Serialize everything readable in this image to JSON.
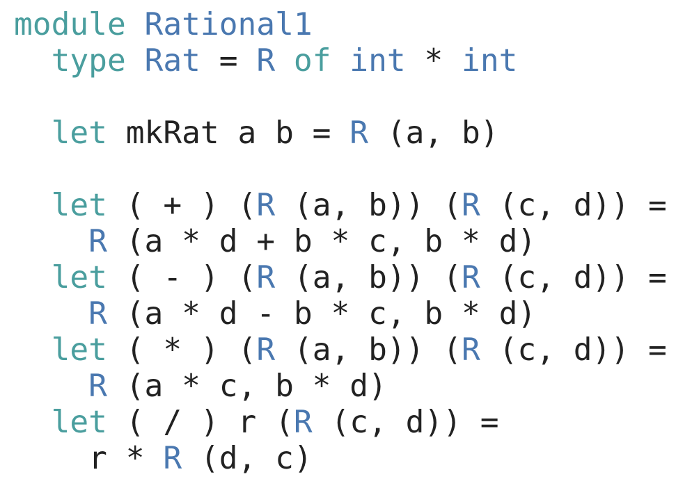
{
  "colors": {
    "keyword": "#4a9e9e",
    "constructor": "#4a78b0",
    "text": "#222222",
    "background": "#ffffff"
  },
  "code": {
    "line1": {
      "kw": "module",
      "sp1": " ",
      "name": "Rational1"
    },
    "line2": {
      "indent": "  ",
      "kw": "type",
      "sp1": " ",
      "name": "Rat",
      "eq": " = ",
      "ctor": "R",
      "sp2": " ",
      "of": "of",
      "sp3": " ",
      "int1": "int",
      "star": " * ",
      "int2": "int"
    },
    "line3": {
      "indent": "  ",
      "kw": "let",
      "rest1": " mkRat a b = ",
      "ctor": "R",
      "rest2": " (a, b)"
    },
    "line4": {
      "indent": "  ",
      "kw": "let",
      "rest1": " ( + ) (",
      "ctor1": "R",
      "rest2": " (a, b)) (",
      "ctor2": "R",
      "rest3": " (c, d)) ="
    },
    "line5": {
      "indent": "    ",
      "ctor": "R",
      "rest": " (a * d + b * c, b * d)"
    },
    "line6": {
      "indent": "  ",
      "kw": "let",
      "rest1": " ( - ) (",
      "ctor1": "R",
      "rest2": " (a, b)) (",
      "ctor2": "R",
      "rest3": " (c, d)) ="
    },
    "line7": {
      "indent": "    ",
      "ctor": "R",
      "rest": " (a * d - b * c, b * d)"
    },
    "line8": {
      "indent": "  ",
      "kw": "let",
      "rest1": " ( * ) (",
      "ctor1": "R",
      "rest2": " (a, b)) (",
      "ctor2": "R",
      "rest3": " (c, d)) ="
    },
    "line9": {
      "indent": "    ",
      "ctor": "R",
      "rest": " (a * c, b * d)"
    },
    "line10": {
      "indent": "  ",
      "kw": "let",
      "rest1": " ( / ) r (",
      "ctor": "R",
      "rest2": " (c, d)) ="
    },
    "line11": {
      "indent": "    ",
      "pre": "r * ",
      "ctor": "R",
      "rest": " (d, c)"
    }
  }
}
